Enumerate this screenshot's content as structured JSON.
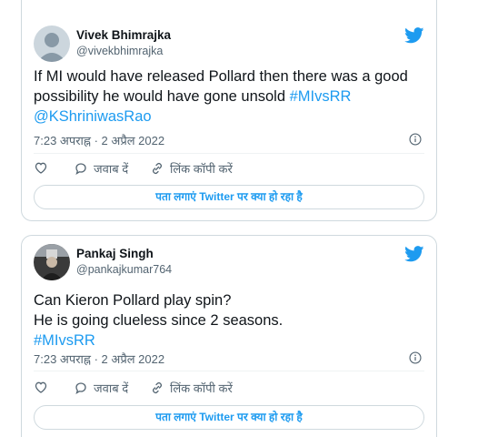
{
  "tweets": [
    {
      "name": "Vivek Bhimrajka",
      "handle": "@vivekbhimrajka",
      "text_plain": "If MI would have released Pollard then there was a good possibility he would have gone unsold ",
      "hashtag": "#MIvsRR",
      "mention": "@KShriniwasRao",
      "timestamp": "7:23 अपराह्न · 2 अप्रैल 2022",
      "reply_label": "जवाब दें",
      "copy_label": "लिंक कॉपी करें",
      "cta_label": "पता लगाएं Twitter पर क्या हो रहा है"
    },
    {
      "name": "Pankaj Singh",
      "handle": "@pankajkumar764",
      "text_plain": "Can Kieron Pollard play spin?\nHe is going clueless since 2 seasons.\n",
      "hashtag": "#MIvsRR",
      "timestamp": "7:23 अपराह्न · 2 अप्रैल 2022",
      "reply_label": "जवाब दें",
      "copy_label": "लिंक कॉपी करें",
      "cta_label": "पता लगाएं Twitter पर क्या हो रहा है"
    }
  ],
  "colors": {
    "accent": "#1d9bf0",
    "muted": "#536471",
    "border": "#cfd9de"
  },
  "icons": [
    "twitter-bird-icon",
    "info-icon",
    "heart-icon",
    "reply-icon",
    "link-icon"
  ]
}
